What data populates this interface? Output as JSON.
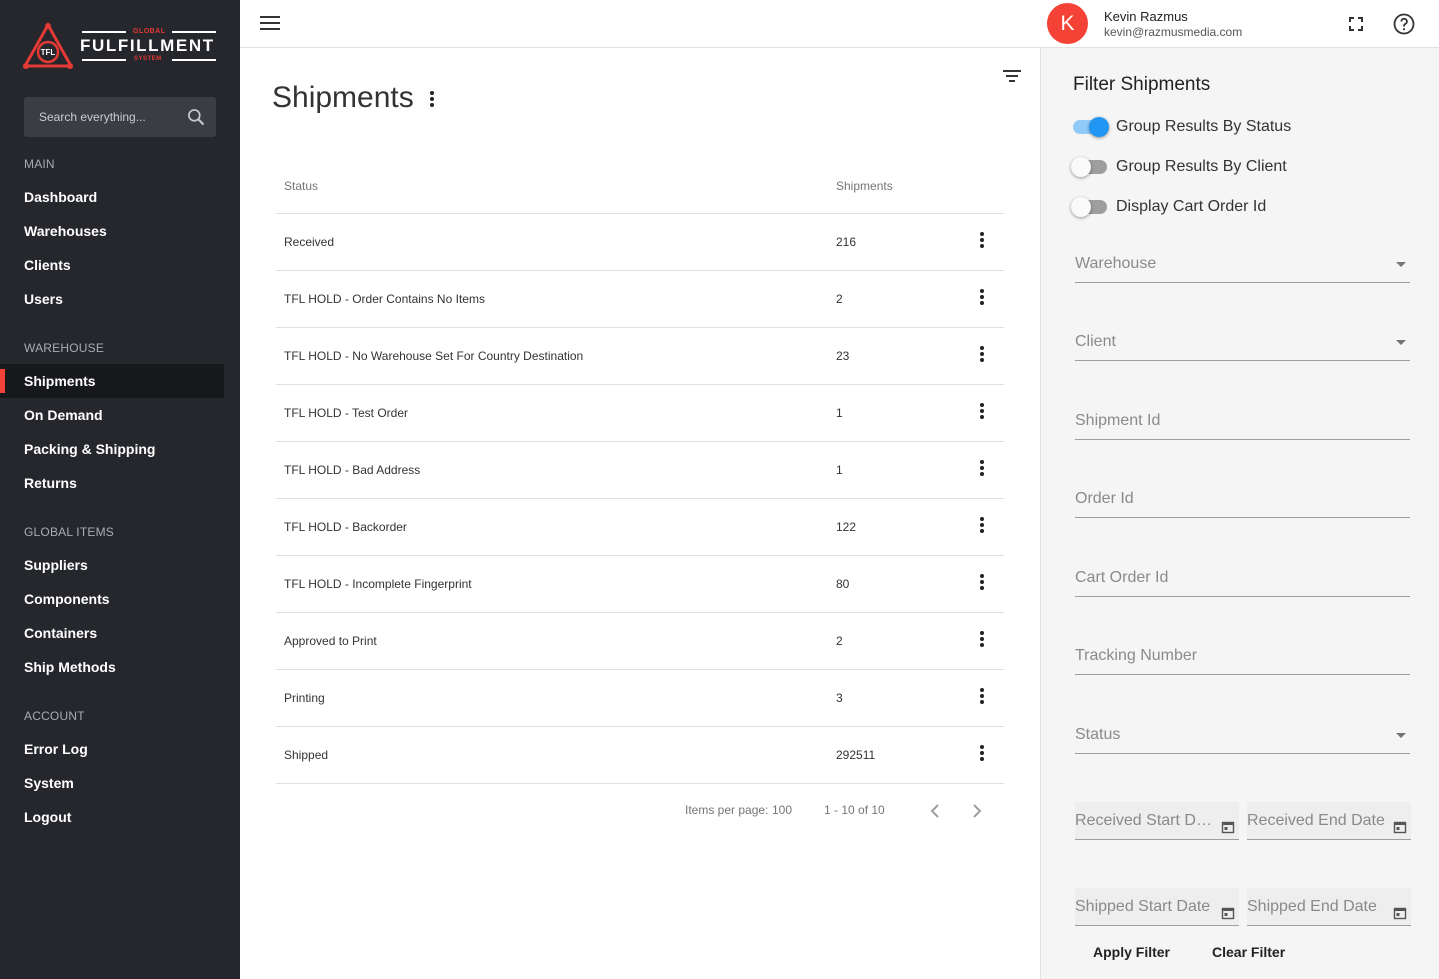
{
  "brand": {
    "top": "GLOBAL",
    "name": "FULFILLMENT",
    "bottom": "SYSTEM",
    "emblem_text": "TFL",
    "accent_color": "#e53935"
  },
  "search": {
    "placeholder": "Search everything..."
  },
  "sidebar": {
    "sections": [
      {
        "label": "MAIN",
        "items": [
          "Dashboard",
          "Warehouses",
          "Clients",
          "Users"
        ]
      },
      {
        "label": "WAREHOUSE",
        "items": [
          "Shipments",
          "On Demand",
          "Packing & Shipping",
          "Returns"
        ]
      },
      {
        "label": "GLOBAL ITEMS",
        "items": [
          "Suppliers",
          "Components",
          "Containers",
          "Ship Methods"
        ]
      },
      {
        "label": "ACCOUNT",
        "items": [
          "Error Log",
          "System",
          "Logout"
        ]
      }
    ],
    "active_item": "Shipments"
  },
  "header": {
    "avatar_letter": "K",
    "user_name": "Kevin Razmus",
    "user_email": "kevin@razmusmedia.com",
    "icons": [
      "menu-icon",
      "fullscreen-icon",
      "help-icon"
    ]
  },
  "main": {
    "title": "Shipments",
    "columns": {
      "status": "Status",
      "shipments": "Shipments"
    },
    "rows": [
      {
        "status": "Received",
        "count": "216"
      },
      {
        "status": "TFL HOLD - Order Contains No Items",
        "count": "2"
      },
      {
        "status": "TFL HOLD - No Warehouse Set For Country Destination",
        "count": "23"
      },
      {
        "status": "TFL HOLD - Test Order",
        "count": "1"
      },
      {
        "status": "TFL HOLD - Bad Address",
        "count": "1"
      },
      {
        "status": "TFL HOLD - Backorder",
        "count": "122"
      },
      {
        "status": "TFL HOLD - Incomplete Fingerprint",
        "count": "80"
      },
      {
        "status": "Approved to Print",
        "count": "2"
      },
      {
        "status": "Printing",
        "count": "3"
      },
      {
        "status": "Shipped",
        "count": "292511"
      }
    ],
    "pager": {
      "items_per_page_label": "Items per page:",
      "items_per_page": "100",
      "range": "1 - 10 of 10"
    }
  },
  "filter": {
    "title": "Filter Shipments",
    "toggles": [
      {
        "label": "Group Results By Status",
        "on": true
      },
      {
        "label": "Group Results By Client",
        "on": false
      },
      {
        "label": "Display Cart Order Id",
        "on": false
      }
    ],
    "fields": {
      "warehouse": "Warehouse",
      "client": "Client",
      "shipment_id": "Shipment Id",
      "order_id": "Order Id",
      "cart_order_id": "Cart Order Id",
      "tracking_number": "Tracking Number",
      "status": "Status",
      "received_start": "Received Start Date",
      "received_end": "Received End Date",
      "shipped_start": "Shipped Start Date",
      "shipped_end": "Shipped End Date"
    },
    "apply_label": "Apply Filter",
    "clear_label": "Clear Filter"
  }
}
